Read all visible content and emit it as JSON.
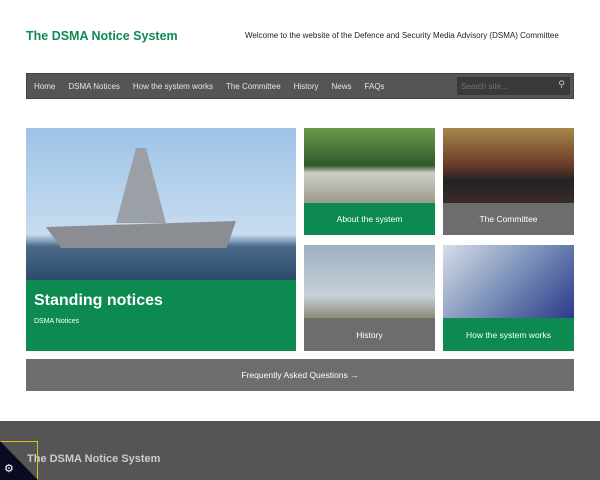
{
  "header": {
    "title": "The DSMA Notice System",
    "welcome": "Welcome to the website of the Defence and Security Media Advisory (DSMA) Committee"
  },
  "nav": {
    "items": [
      "Home",
      "DSMA Notices",
      "How the system works",
      "The Committee",
      "History",
      "News",
      "FAQs"
    ],
    "search_placeholder": "Search site..."
  },
  "hero": {
    "title": "Standing notices",
    "subtitle": "DSMA Notices"
  },
  "tiles": [
    "About the system",
    "The Committee",
    "History",
    "How the system works"
  ],
  "faq": "Frequently Asked Questions →",
  "footer": {
    "title": "The DSMA Notice System"
  },
  "colors": {
    "green": "#0c8a4f",
    "gray": "#6d6d6d",
    "nav": "#555555"
  }
}
